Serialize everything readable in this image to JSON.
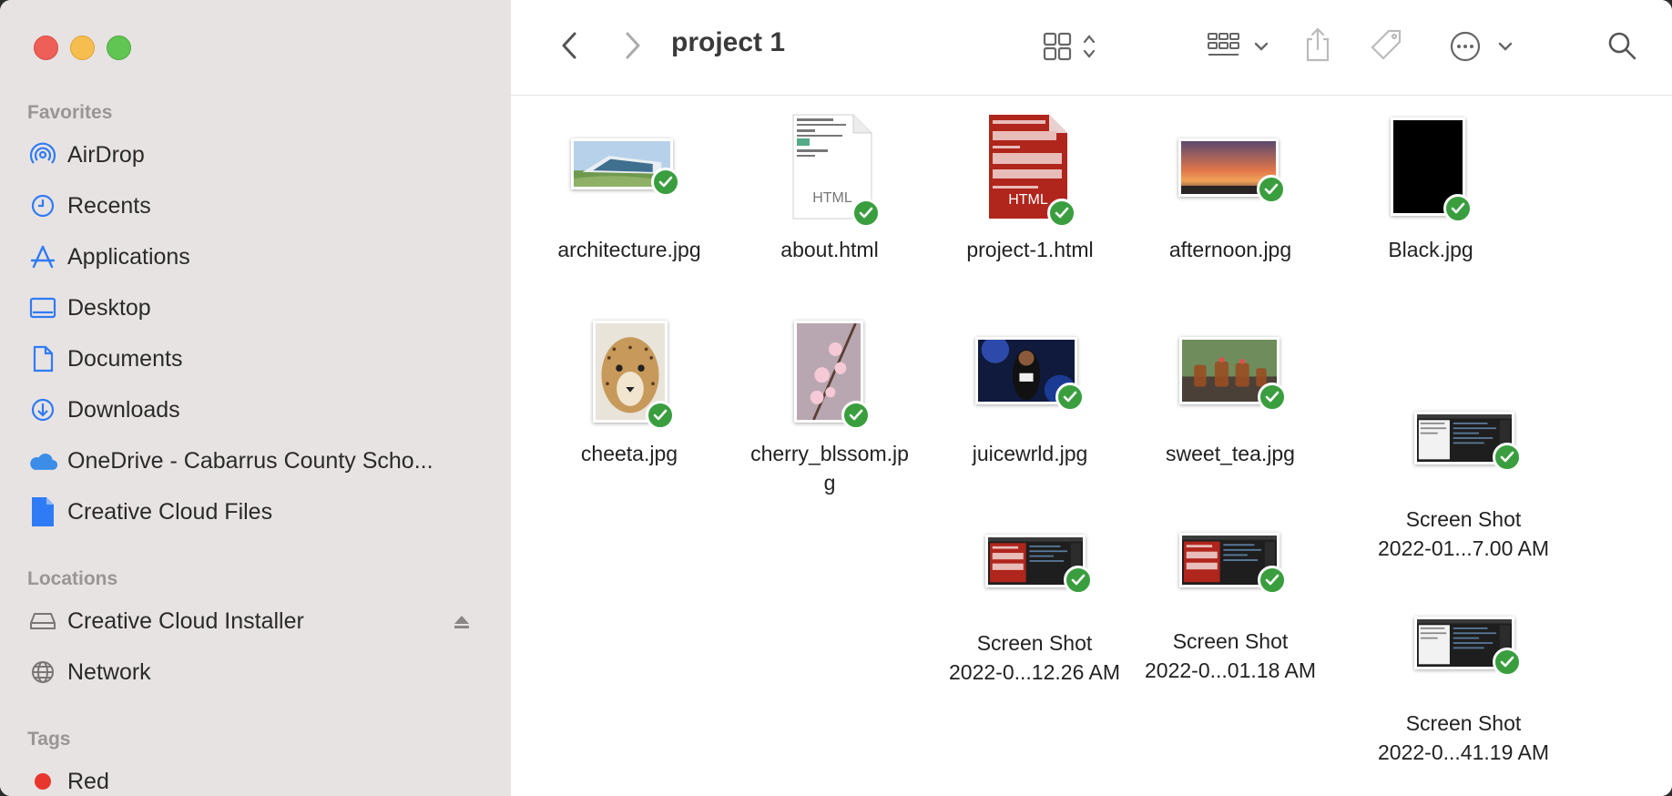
{
  "sidebar": {
    "favorites_title": "Favorites",
    "favorites": [
      {
        "label": "AirDrop",
        "icon": "airdrop-icon"
      },
      {
        "label": "Recents",
        "icon": "clock-icon"
      },
      {
        "label": "Applications",
        "icon": "applications-icon"
      },
      {
        "label": "Desktop",
        "icon": "desktop-icon"
      },
      {
        "label": "Documents",
        "icon": "document-icon"
      },
      {
        "label": "Downloads",
        "icon": "download-icon"
      },
      {
        "label": "OneDrive - Cabarrus County Scho...",
        "icon": "cloud-icon"
      },
      {
        "label": "Creative Cloud Files",
        "icon": "file-icon"
      }
    ],
    "locations_title": "Locations",
    "locations": [
      {
        "label": "Creative Cloud Installer",
        "icon": "drive-icon"
      },
      {
        "label": "Network",
        "icon": "globe-icon"
      }
    ],
    "tags_title": "Tags",
    "tags": [
      {
        "label": "Red",
        "color": "#e8362e"
      }
    ]
  },
  "toolbar": {
    "title": "project 1"
  },
  "files": [
    {
      "name": "architecture.jpg",
      "name2": "",
      "kind": "architecture"
    },
    {
      "name": "about.html",
      "name2": "",
      "kind": "html-white",
      "badge": "HTML"
    },
    {
      "name": "project-1.html",
      "name2": "",
      "kind": "html-red",
      "badge": "HTML"
    },
    {
      "name": "afternoon.jpg",
      "name2": "",
      "kind": "sunset"
    },
    {
      "name": "Black.jpg",
      "name2": "",
      "kind": "black"
    },
    {
      "name": "cheeta.jpg",
      "name2": "",
      "kind": "cheetah"
    },
    {
      "name": "cherry_blssom.jp",
      "name2": "g",
      "kind": "cherry"
    },
    {
      "name": "juicewrld.jpg",
      "name2": "",
      "kind": "concert"
    },
    {
      "name": "sweet_tea.jpg",
      "name2": "",
      "kind": "tea"
    },
    {
      "name": "Screen Shot",
      "name2": "2022-01...7.00 AM",
      "kind": "screenshot-dark"
    },
    {
      "name": "Screen Shot",
      "name2": "2022-0...12.26 AM",
      "kind": "screenshot-red"
    },
    {
      "name": "Screen Shot",
      "name2": "2022-0...01.18 AM",
      "kind": "screenshot-red2"
    },
    {
      "name": "Screen Shot",
      "name2": "2022-0...41.19 AM",
      "kind": "screenshot-dark2"
    }
  ],
  "colors": {
    "sidebar_bg": "#e8e3e3",
    "accent": "#2f7bf5",
    "check": "#3a9e3f"
  }
}
